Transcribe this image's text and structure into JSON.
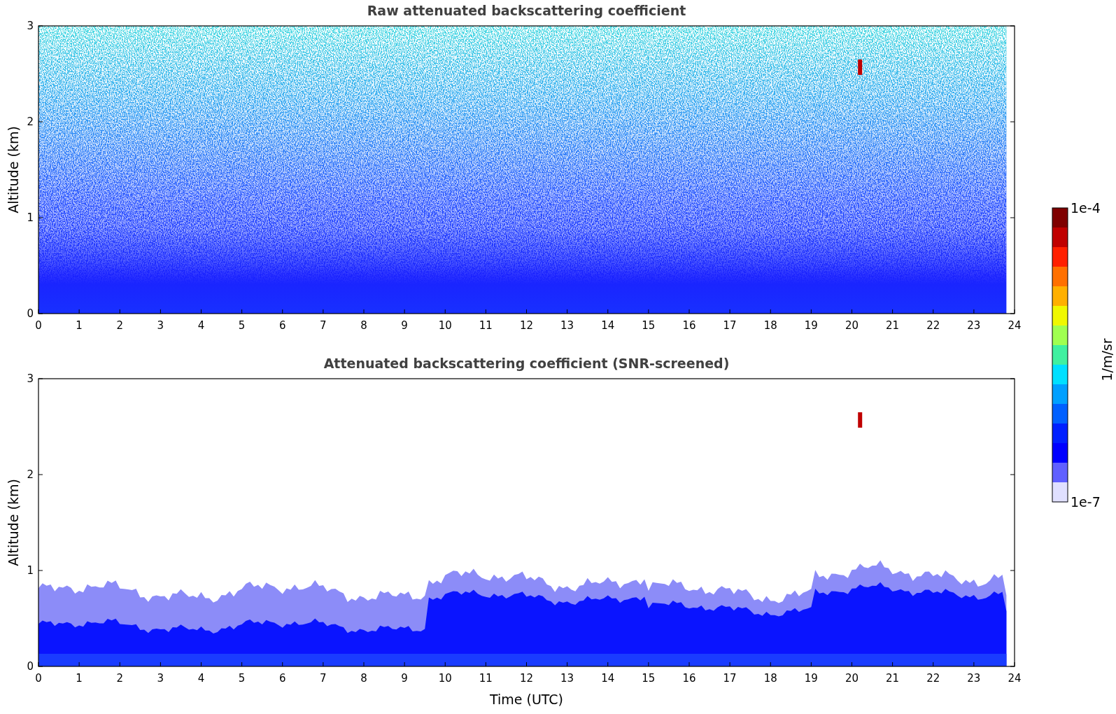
{
  "panels": [
    {
      "kind": "raw",
      "title": "Raw attenuated backscattering coefficient",
      "ylabel": "Altitude (km)",
      "yticks": [
        "3",
        "2",
        "1",
        "0"
      ],
      "xticks": [
        "0",
        "1",
        "2",
        "3",
        "4",
        "5",
        "6",
        "7",
        "8",
        "9",
        "10",
        "11",
        "12",
        "13",
        "14",
        "15",
        "16",
        "17",
        "18",
        "19",
        "20",
        "21",
        "22",
        "23",
        "24"
      ]
    },
    {
      "kind": "screened",
      "title": "Attenuated backscattering coefficient (SNR-screened)",
      "ylabel": "Altitude (km)",
      "yticks": [
        "3",
        "2",
        "1",
        "0"
      ],
      "xticks": [
        "0",
        "1",
        "2",
        "3",
        "4",
        "5",
        "6",
        "7",
        "8",
        "9",
        "10",
        "11",
        "12",
        "13",
        "14",
        "15",
        "16",
        "17",
        "18",
        "19",
        "20",
        "21",
        "22",
        "23",
        "24"
      ],
      "xlabel": "Time (UTC)"
    }
  ],
  "colorbar": {
    "label": "1/m/sr",
    "max_label": "1e-4",
    "min_label": "1e-7"
  }
}
